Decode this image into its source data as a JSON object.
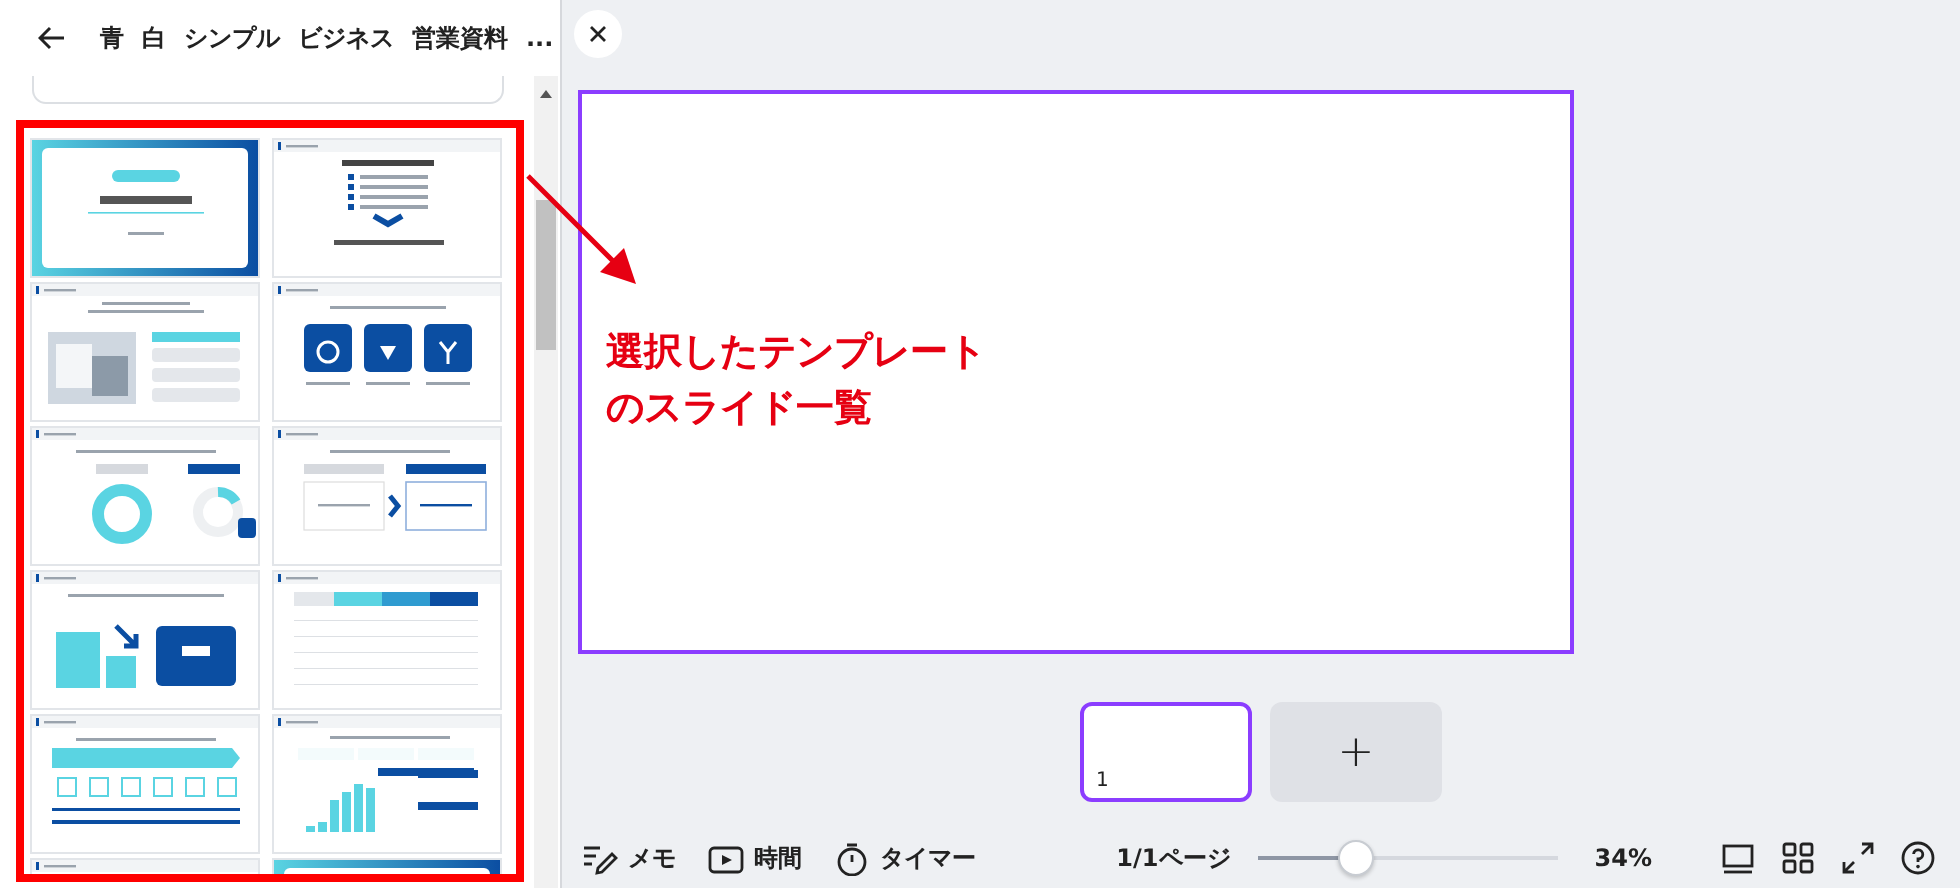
{
  "header": {
    "tags": [
      "青",
      "白",
      "シンプル",
      "ビジネス",
      "営業資料",
      "..."
    ]
  },
  "slides": [
    {
      "kind": "cover"
    },
    {
      "kind": "checklist"
    },
    {
      "kind": "photo"
    },
    {
      "kind": "icons"
    },
    {
      "kind": "donut"
    },
    {
      "kind": "compare"
    },
    {
      "kind": "bars"
    },
    {
      "kind": "table"
    },
    {
      "kind": "process"
    },
    {
      "kind": "chart"
    },
    {
      "kind": "heading"
    },
    {
      "kind": "cover"
    }
  ],
  "annotation": {
    "lines": [
      "選択したテンプレート",
      "のスライド一覧"
    ]
  },
  "pages": [
    {
      "number": "1",
      "selected": true
    }
  ],
  "add_page": {
    "label": "+"
  },
  "tools": [
    {
      "kind": "notes",
      "label": "メモ"
    },
    {
      "kind": "duration",
      "label": "時間"
    },
    {
      "kind": "timer",
      "label": "タイマー"
    }
  ],
  "page_count": "1/1ページ",
  "zoom": {
    "level": 0.32,
    "reading": "34%"
  }
}
